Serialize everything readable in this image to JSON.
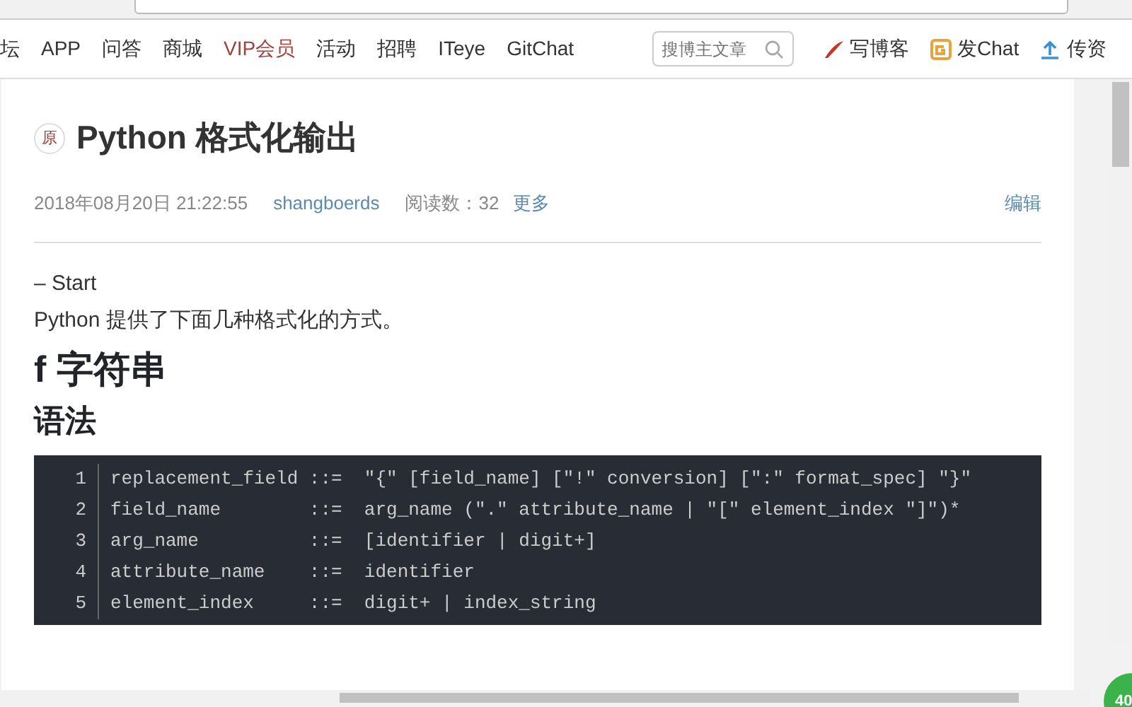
{
  "nav": {
    "items": [
      {
        "label": "坛",
        "highlight": false
      },
      {
        "label": "APP",
        "highlight": false
      },
      {
        "label": "问答",
        "highlight": false
      },
      {
        "label": "商城",
        "highlight": false
      },
      {
        "label": "VIP会员",
        "highlight": true
      },
      {
        "label": "活动",
        "highlight": false
      },
      {
        "label": "招聘",
        "highlight": false
      },
      {
        "label": "ITeye",
        "highlight": false
      },
      {
        "label": "GitChat",
        "highlight": false
      }
    ],
    "search": {
      "placeholder": "搜博主文章"
    },
    "actions": [
      {
        "kind": "write",
        "label": "写博客"
      },
      {
        "kind": "chat",
        "label": "发Chat"
      },
      {
        "kind": "upload",
        "label": "传资"
      }
    ]
  },
  "article": {
    "badge": "原",
    "title": "Python 格式化输出",
    "date": "2018年08月20日 21:22:55",
    "author": "shangboerds",
    "reads": "阅读数：32",
    "more": "更多",
    "edit": "编辑",
    "paragraphs": [
      "– Start",
      "Python 提供了下面几种格式化的方式。"
    ],
    "h1": "f 字符串",
    "h2": "语法",
    "code": [
      {
        "num": "1",
        "text": "replacement_field ::=  \"{\" [field_name] [\"!\" conversion] [\":\" format_spec] \"}\""
      },
      {
        "num": "2",
        "text": "field_name        ::=  arg_name (\".\" attribute_name | \"[\" element_index \"]\")*"
      },
      {
        "num": "3",
        "text": "arg_name          ::=  [identifier | digit+]"
      },
      {
        "num": "4",
        "text": "attribute_name    ::=  identifier"
      },
      {
        "num": "5",
        "text": "element_index     ::=  digit+ | index_string"
      }
    ]
  },
  "float_badge": "40"
}
